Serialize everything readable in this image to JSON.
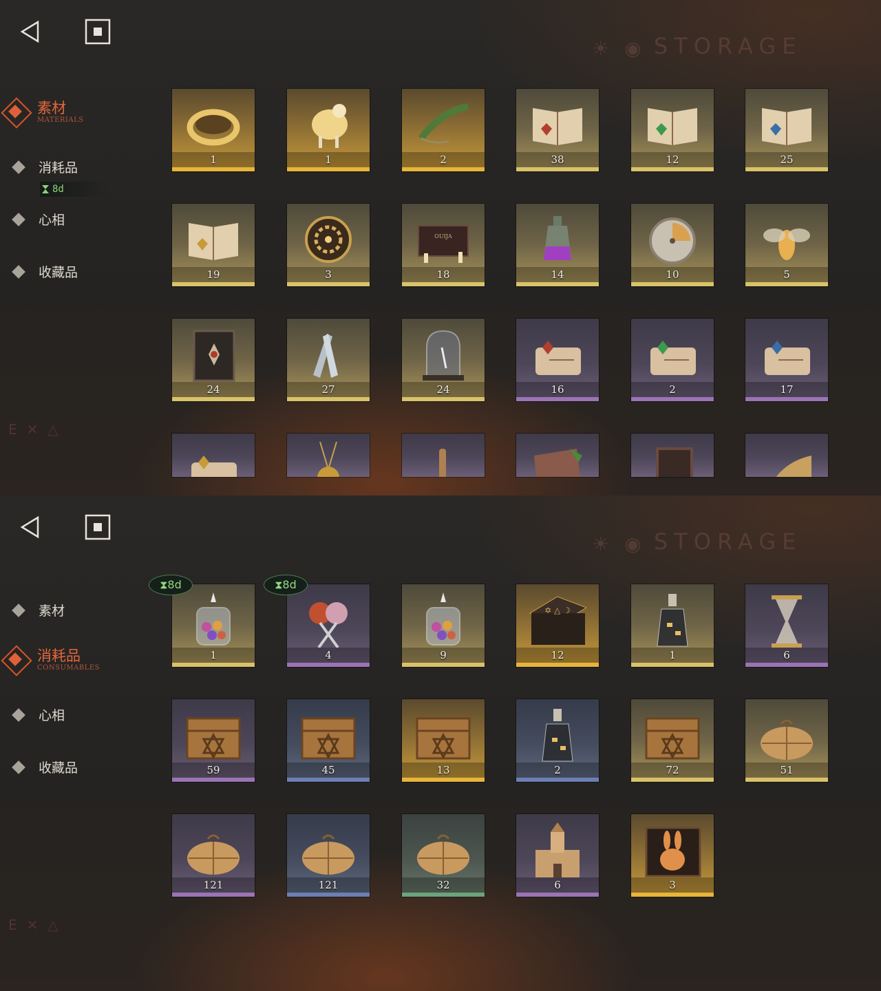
{
  "screens": [
    {
      "title": "STORAGE",
      "nav": [
        {
          "label": "素材",
          "sub": "MATERIALS",
          "active": true
        },
        {
          "label": "消耗品",
          "sub": "",
          "active": false
        },
        {
          "label": "心相",
          "sub": "",
          "active": false
        },
        {
          "label": "收藏品",
          "sub": "",
          "active": false
        }
      ],
      "nav_timer": "8d",
      "items": [
        {
          "count": "1",
          "rarity": "gold",
          "icon": "gold-ring-icon"
        },
        {
          "count": "1",
          "rarity": "gold",
          "icon": "sheep-figure-icon"
        },
        {
          "count": "2",
          "rarity": "gold",
          "icon": "laurel-wreath-icon"
        },
        {
          "count": "38",
          "rarity": "yellow",
          "icon": "open-book-red-icon"
        },
        {
          "count": "12",
          "rarity": "yellow",
          "icon": "open-book-green-icon"
        },
        {
          "count": "25",
          "rarity": "yellow",
          "icon": "open-book-blue-icon"
        },
        {
          "count": "19",
          "rarity": "yellow",
          "icon": "open-book-gold-icon"
        },
        {
          "count": "3",
          "rarity": "yellow",
          "icon": "clockwork-gear-icon"
        },
        {
          "count": "18",
          "rarity": "yellow",
          "icon": "ouija-board-icon"
        },
        {
          "count": "14",
          "rarity": "yellow",
          "icon": "potion-bottle-icon"
        },
        {
          "count": "10",
          "rarity": "yellow",
          "icon": "pocket-watch-icon"
        },
        {
          "count": "5",
          "rarity": "yellow",
          "icon": "firefly-icon"
        },
        {
          "count": "24",
          "rarity": "yellow",
          "icon": "dark-tome-icon"
        },
        {
          "count": "27",
          "rarity": "yellow",
          "icon": "silver-bullets-icon"
        },
        {
          "count": "24",
          "rarity": "yellow",
          "icon": "bell-jar-icon"
        },
        {
          "count": "16",
          "rarity": "purple",
          "icon": "scroll-red-icon"
        },
        {
          "count": "2",
          "rarity": "purple",
          "icon": "scroll-green-icon"
        },
        {
          "count": "17",
          "rarity": "purple",
          "icon": "scroll-blue-icon"
        },
        {
          "count": "",
          "rarity": "purple",
          "icon": "scroll-gold-icon"
        },
        {
          "count": "",
          "rarity": "purple",
          "icon": "amulet-icon"
        },
        {
          "count": "",
          "rarity": "purple",
          "icon": "key-charm-icon"
        },
        {
          "count": "",
          "rarity": "purple",
          "icon": "stone-tablet-icon"
        },
        {
          "count": "",
          "rarity": "purple",
          "icon": "frame-icon"
        },
        {
          "count": "",
          "rarity": "purple",
          "icon": "brass-gadget-icon"
        }
      ]
    },
    {
      "title": "STORAGE",
      "nav": [
        {
          "label": "素材",
          "sub": "",
          "active": false
        },
        {
          "label": "消耗品",
          "sub": "CONSUMABLES",
          "active": true
        },
        {
          "label": "心相",
          "sub": "",
          "active": false
        },
        {
          "label": "收藏品",
          "sub": "",
          "active": false
        }
      ],
      "items": [
        {
          "count": "1",
          "rarity": "yellow",
          "icon": "candy-jar-icon",
          "timer": "8d"
        },
        {
          "count": "4",
          "rarity": "purple",
          "icon": "lollipop-icon",
          "timer": "8d"
        },
        {
          "count": "9",
          "rarity": "yellow",
          "icon": "candy-jar-icon"
        },
        {
          "count": "12",
          "rarity": "gold",
          "icon": "rune-table-icon"
        },
        {
          "count": "1",
          "rarity": "yellow",
          "icon": "message-bottle-icon"
        },
        {
          "count": "6",
          "rarity": "purple",
          "icon": "hourglass-icon"
        },
        {
          "count": "59",
          "rarity": "purple",
          "icon": "wooden-crate-icon"
        },
        {
          "count": "45",
          "rarity": "blue",
          "icon": "wooden-crate-icon"
        },
        {
          "count": "13",
          "rarity": "gold",
          "icon": "wooden-crate-icon"
        },
        {
          "count": "2",
          "rarity": "blue",
          "icon": "message-bottle-icon"
        },
        {
          "count": "72",
          "rarity": "yellow",
          "icon": "wooden-crate-icon"
        },
        {
          "count": "51",
          "rarity": "yellow",
          "icon": "parcel-icon"
        },
        {
          "count": "121",
          "rarity": "purple",
          "icon": "parcel-icon"
        },
        {
          "count": "121",
          "rarity": "blue",
          "icon": "parcel-icon"
        },
        {
          "count": "32",
          "rarity": "green",
          "icon": "parcel-icon"
        },
        {
          "count": "6",
          "rarity": "purple",
          "icon": "block-castle-icon"
        },
        {
          "count": "3",
          "rarity": "gold",
          "icon": "rabbit-box-icon"
        }
      ]
    }
  ]
}
